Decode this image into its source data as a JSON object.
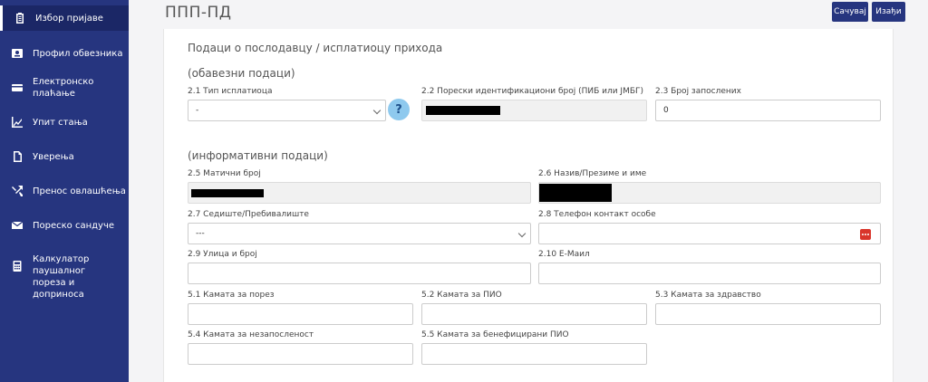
{
  "app": {
    "title": "ППП-ПД"
  },
  "sidebar": {
    "items": [
      {
        "label": "Избор пријаве",
        "icon": "clipboard-icon"
      },
      {
        "label": "Профил обвезника",
        "icon": "id-card-icon"
      },
      {
        "label": "Електронско плаћање",
        "icon": "credit-card-icon"
      },
      {
        "label": "Упит стања",
        "icon": "chart-icon"
      },
      {
        "label": "Уверења",
        "icon": "document-icon"
      },
      {
        "label": "Пренос овлашћења",
        "icon": "transfer-icon"
      },
      {
        "label": "Пореско сандуче",
        "icon": "envelope-icon"
      },
      {
        "label_line1": "Калкулатор паушалног",
        "label_line2": "пореза и доприноса",
        "icon": "calculator-icon"
      }
    ]
  },
  "toolbar": {
    "save_label": "Сачувај",
    "exit_label": "Изађи"
  },
  "form": {
    "heading": "Подаци о послодавцу / исплатиоцу прихода",
    "mandatory_title": "(обавезни подаци)",
    "informative_title": "(информативни подаци)",
    "f21": {
      "label": "2.1 Тип исплатиоца",
      "value": "-"
    },
    "f22": {
      "label": "2.2 Порески идентификациони број (ПИБ или ЈМБГ)"
    },
    "f23": {
      "label": "2.3 Број запослених",
      "value": "0"
    },
    "f25": {
      "label": "2.5 Матични број"
    },
    "f26": {
      "label": "2.6 Назив/Презиме и име"
    },
    "f27": {
      "label": "2.7 Седиште/Пребивалиште",
      "value": "---"
    },
    "f28": {
      "label": "2.8 Телефон контакт особе"
    },
    "f29": {
      "label": "2.9 Улица и број"
    },
    "f210": {
      "label": "2.10 Е-Маил"
    },
    "f51": {
      "label": "5.1 Камата за порез"
    },
    "f52": {
      "label": "5.2 Камата за ПИО"
    },
    "f53": {
      "label": "5.3 Камата за здравство"
    },
    "f54": {
      "label": "5.4 Камата за незапосленост"
    },
    "f55": {
      "label": "5.5 Камата за бенефицирани ПИО"
    },
    "help_glyph": "?"
  },
  "colors": {
    "sidebar": "#26357f",
    "button": "#26357f",
    "help": "#8ec9ee",
    "alert": "#d9352b"
  }
}
